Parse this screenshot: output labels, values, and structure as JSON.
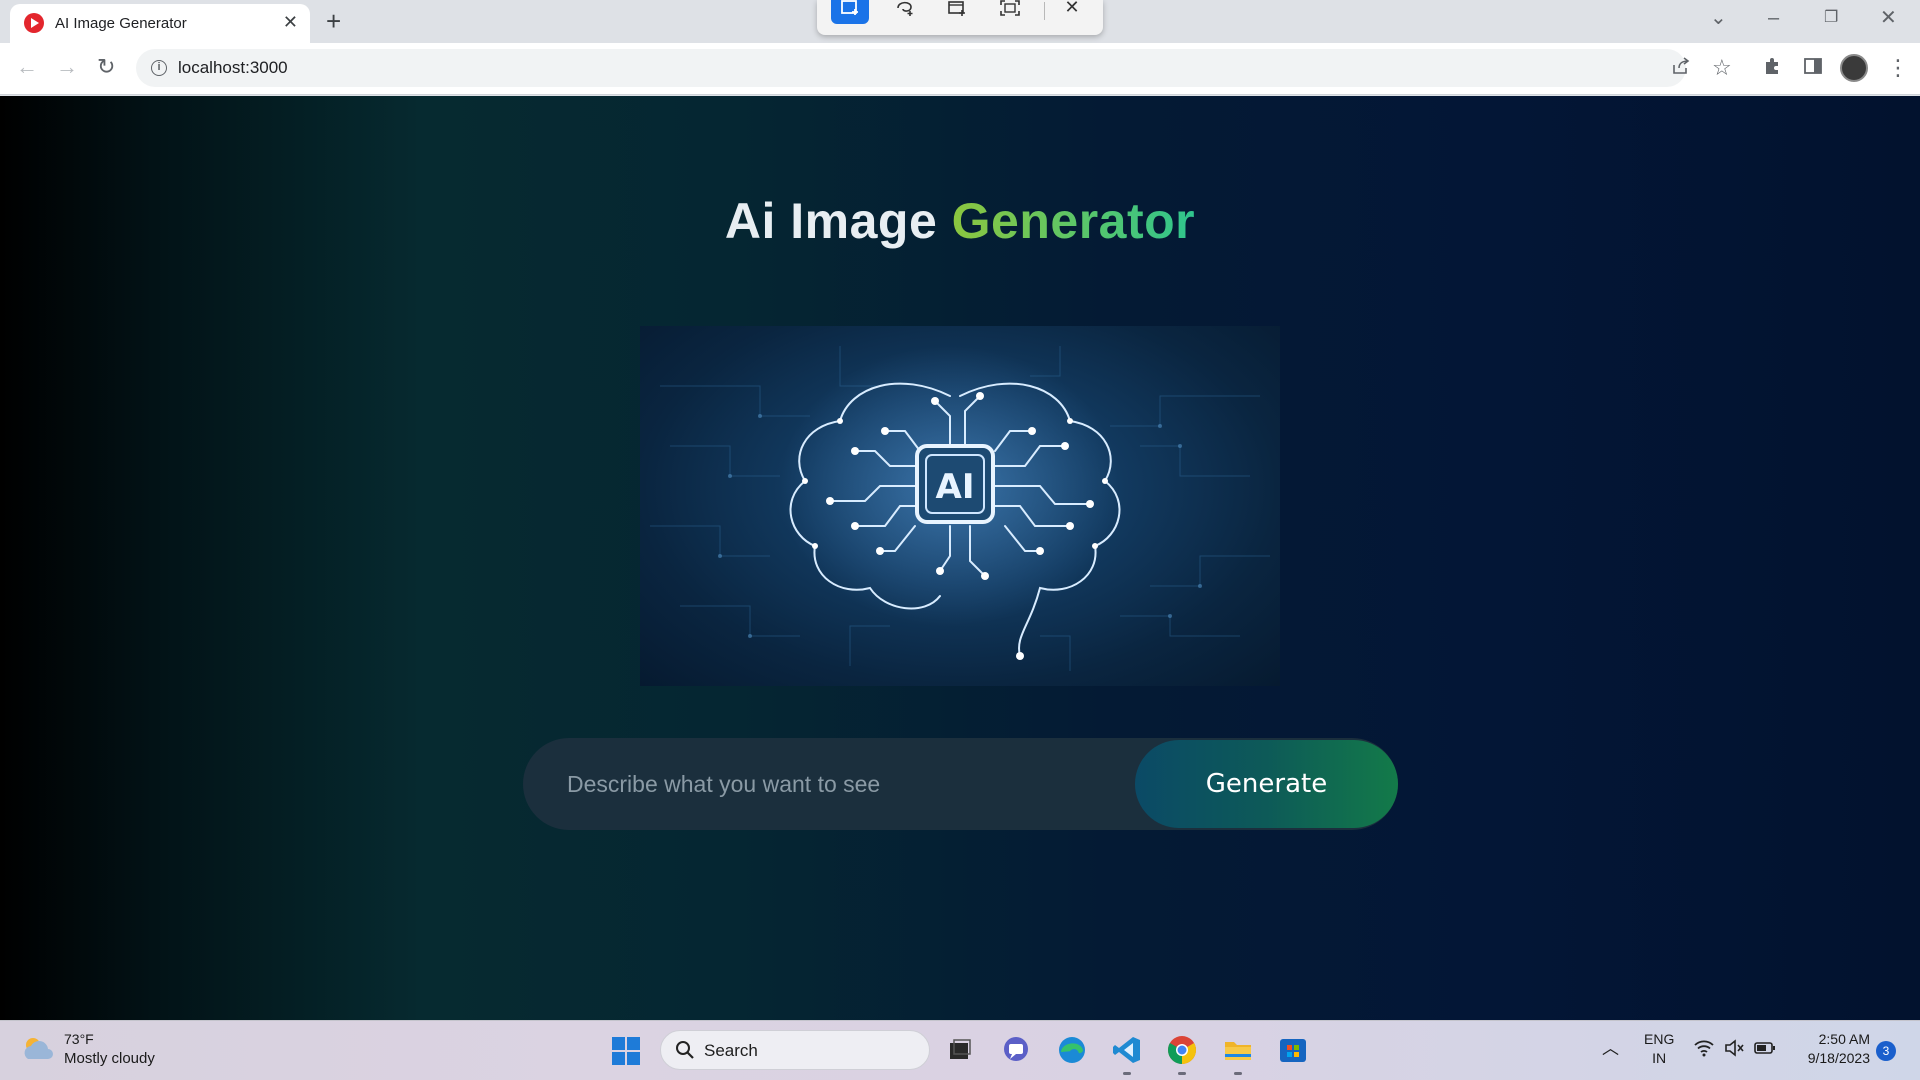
{
  "browser": {
    "tab_title": "AI Image Generator",
    "tab_close": "✕",
    "new_tab": "+",
    "url": "localhost:3000",
    "info_icon": "i"
  },
  "app": {
    "title_main": "Ai Image ",
    "title_accent": "Generator",
    "hero_chip_text": "AI",
    "prompt_placeholder": "Describe what you want to see",
    "generate_label": "Generate"
  },
  "taskbar": {
    "weather_temp": "73°F",
    "weather_condition": "Mostly cloudy",
    "search_label": "Search",
    "lang_line1": "ENG",
    "lang_line2": "IN",
    "time": "2:50 AM",
    "date": "9/18/2023",
    "notification_count": "3"
  },
  "colors": {
    "title_accent_start": "#8cc63f",
    "title_accent_end": "#2fc58e",
    "generate_button": "#0d5a58"
  }
}
